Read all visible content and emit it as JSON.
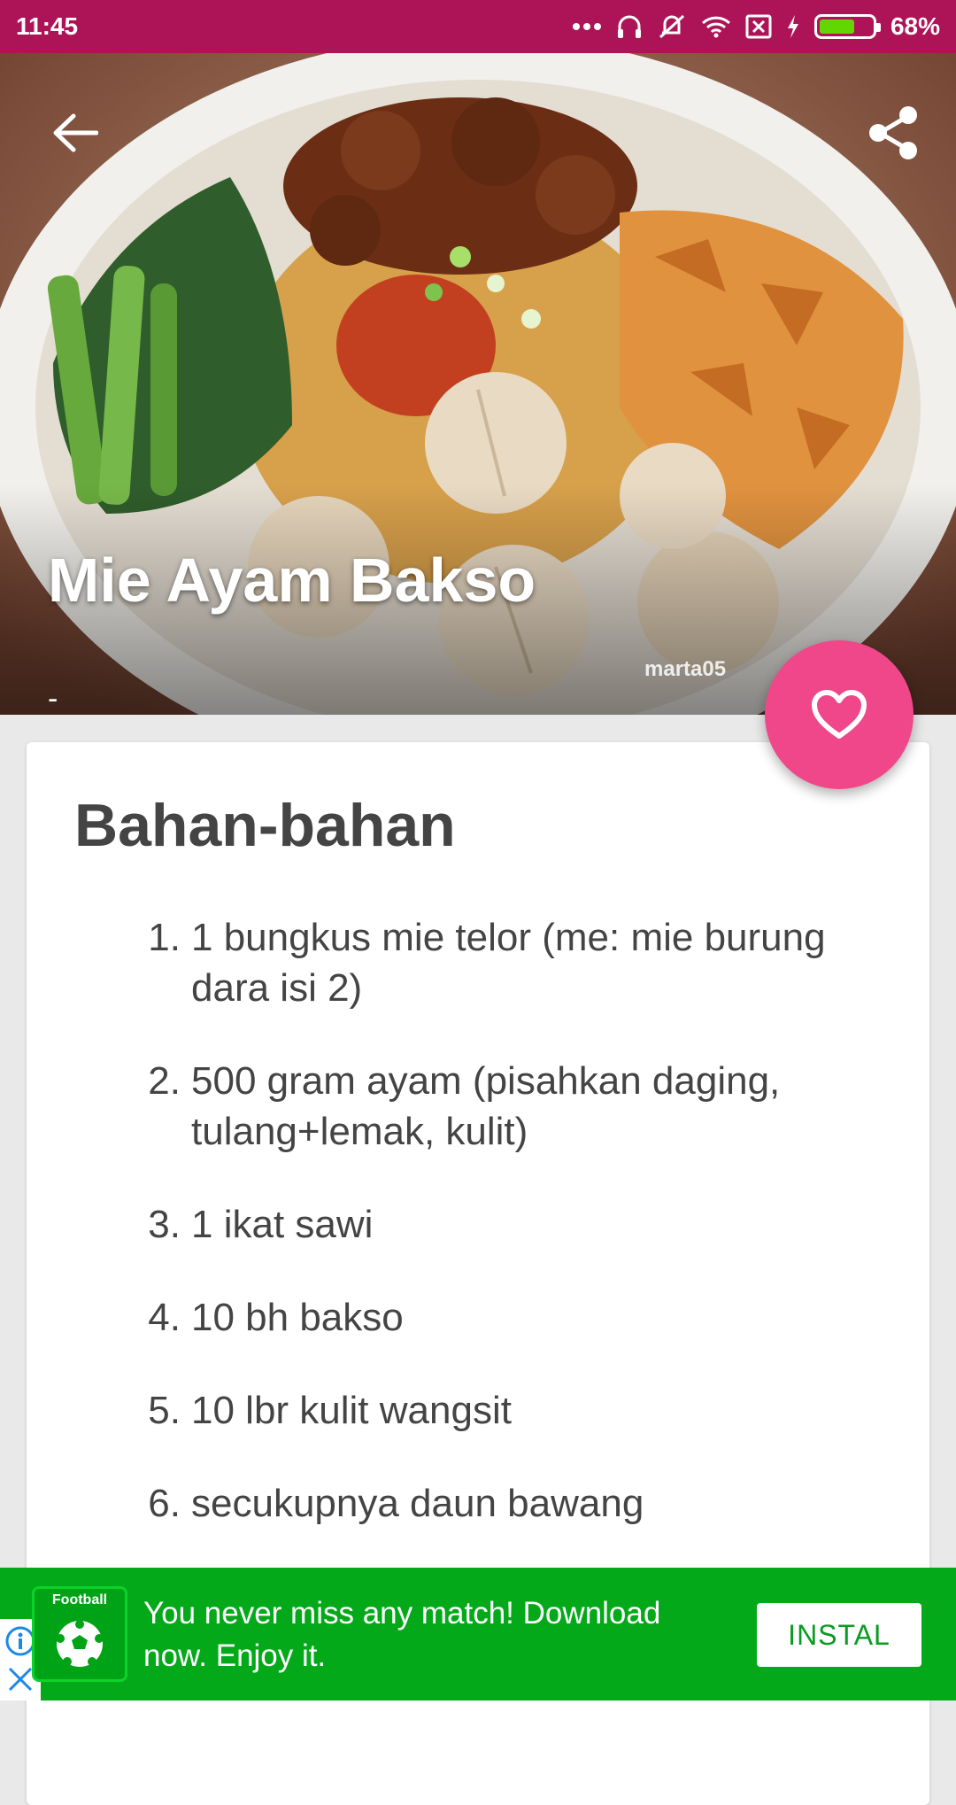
{
  "status_bar": {
    "time": "11:45",
    "battery_percent_label": "68%",
    "battery_level": 0.68,
    "icons": [
      "more-dots-icon",
      "headset-icon",
      "vibrate-off-icon",
      "wifi-icon",
      "sim-off-icon",
      "charging-icon",
      "battery-icon"
    ]
  },
  "hero": {
    "title": "Mie Ayam Bakso",
    "subtitle": "-",
    "photo_watermark": "marta05"
  },
  "toolbar": {
    "back_icon": "arrow-back-icon",
    "share_icon": "share-icon"
  },
  "fab": {
    "icon": "heart-outline-icon"
  },
  "ingredients": {
    "heading": "Bahan-bahan",
    "items": [
      {
        "num": "1.",
        "text": "1 bungkus mie telor (me: mie burung dara isi 2)"
      },
      {
        "num": "2.",
        "text": "500 gram ayam (pisahkan daging, tulang+lemak, kulit)"
      },
      {
        "num": "3.",
        "text": "1 ikat sawi"
      },
      {
        "num": "4.",
        "text": "10 bh bakso"
      },
      {
        "num": "5.",
        "text": "10 lbr kulit wangsit"
      },
      {
        "num": "6.",
        "text": "secukupnya daun bawang"
      }
    ]
  },
  "ad": {
    "app_icon_label": "Football",
    "text": "You never miss any match! Download now. Enjoy it.",
    "button_label": "INSTAL",
    "colors": {
      "background": "#04a91a",
      "button_text": "#0a9b22"
    }
  },
  "colors": {
    "status_bar": "#ad1457",
    "fab": "#f0478a",
    "text": "#444444"
  }
}
